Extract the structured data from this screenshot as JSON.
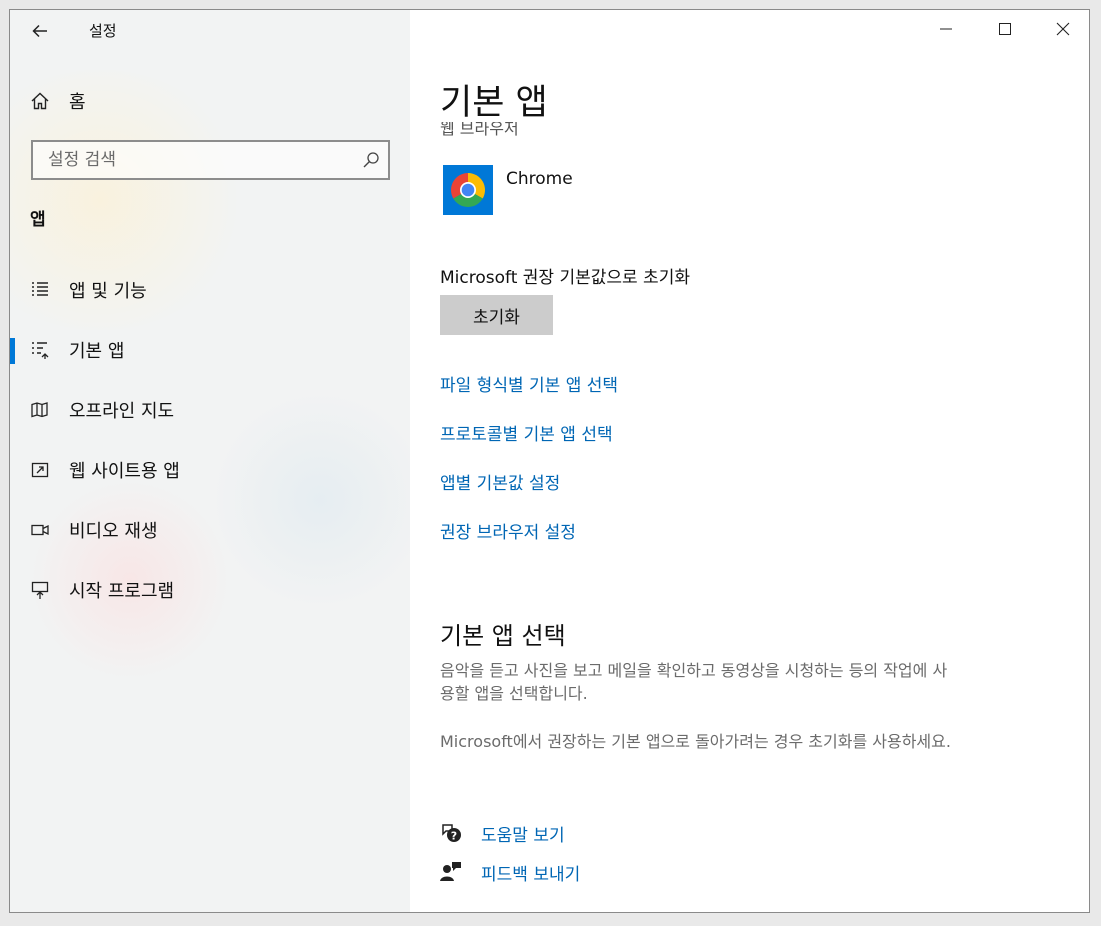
{
  "window": {
    "title": "설정"
  },
  "sidebar": {
    "home_label": "홈",
    "search_placeholder": "설정 검색",
    "section_label": "앱",
    "items": [
      {
        "label": "앱 및 기능",
        "icon": "list-icon"
      },
      {
        "label": "기본 앱",
        "icon": "default-apps-icon",
        "active": true
      },
      {
        "label": "오프라인 지도",
        "icon": "map-icon"
      },
      {
        "label": "웹 사이트용 앱",
        "icon": "web-app-icon"
      },
      {
        "label": "비디오 재생",
        "icon": "video-icon"
      },
      {
        "label": "시작 프로그램",
        "icon": "startup-icon"
      }
    ]
  },
  "main": {
    "title": "기본 앱",
    "cut_off_label": "웹 브라우저",
    "default_browser": {
      "name": "Chrome"
    },
    "reset": {
      "heading": "Microsoft 권장 기본값으로 초기화",
      "button_label": "초기화"
    },
    "links": [
      "파일 형식별 기본 앱 선택",
      "프로토콜별 기본 앱 선택",
      "앱별 기본값 설정",
      "권장 브라우저 설정"
    ],
    "choose_section": {
      "title": "기본 앱 선택",
      "desc1_line1": "음악을 듣고 사진을 보고 메일을 확인하고 동영상을 시청하는 등의 작업에 사",
      "desc1_line2": "용할 앱을 선택합니다.",
      "desc2": "Microsoft에서 권장하는 기본 앱으로 돌아가려는 경우 초기화를 사용하세요."
    },
    "help": {
      "help_label": "도움말 보기",
      "feedback_label": "피드백 보내기"
    }
  },
  "colors": {
    "accent": "#0078d7",
    "link": "#0066b4",
    "sidebar_bg": "#f2f3f3"
  }
}
